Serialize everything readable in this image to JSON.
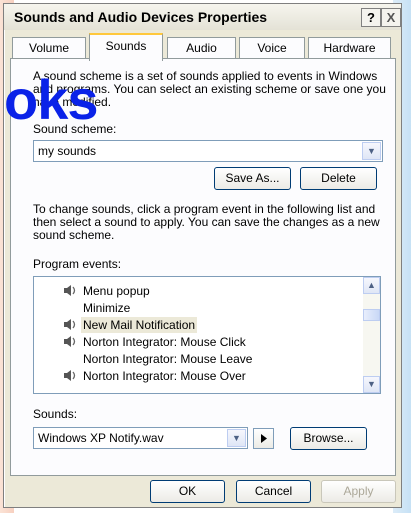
{
  "window": {
    "title": "Sounds and Audio Devices Properties",
    "help_label": "?",
    "close_label": "X"
  },
  "tabs": [
    {
      "label": "Volume"
    },
    {
      "label": "Sounds"
    },
    {
      "label": "Audio"
    },
    {
      "label": "Voice"
    },
    {
      "label": "Hardware"
    }
  ],
  "overlay_text": "oks",
  "intro_lines": [
    "A sound scheme is a set of sounds applied to events in Windows",
    "and programs. You can select an existing scheme or save one you",
    "have modified."
  ],
  "scheme": {
    "label": "Sound scheme:",
    "value": "my sounds",
    "save_as": "Save As...",
    "delete": "Delete"
  },
  "help_lines": [
    "To change sounds, click a program event in the following list and",
    "then select a sound to apply. You can save the changes as a new",
    "sound scheme."
  ],
  "events": {
    "label": "Program events:",
    "items": [
      {
        "label": "Menu popup",
        "icon": "speaker-icon"
      },
      {
        "label": "Minimize",
        "icon": ""
      },
      {
        "label": "New Mail Notification",
        "icon": "speaker-icon",
        "selected": true
      },
      {
        "label": "Norton Integrator: Mouse Click",
        "icon": "speaker-icon"
      },
      {
        "label": "Norton Integrator: Mouse Leave",
        "icon": ""
      },
      {
        "label": "Norton Integrator: Mouse Over",
        "icon": "speaker-icon"
      }
    ]
  },
  "sounds": {
    "label": "Sounds:",
    "value": "Windows XP Notify.wav",
    "browse": "Browse..."
  },
  "footer": {
    "ok": "OK",
    "cancel": "Cancel",
    "apply": "Apply"
  }
}
